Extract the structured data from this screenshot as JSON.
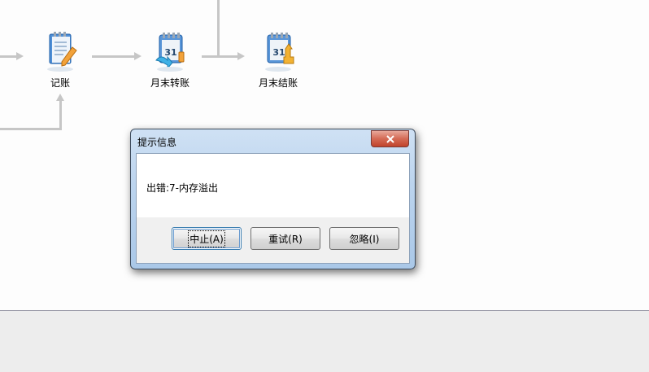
{
  "workflow": {
    "nodes": [
      {
        "label": "记账",
        "icon": "ledger-pen-icon"
      },
      {
        "label": "月末转账",
        "icon": "calendar-transfer-icon"
      },
      {
        "label": "月末结账",
        "icon": "calendar-close-icon"
      }
    ],
    "calendar_day": "31"
  },
  "dialog": {
    "title": "提示信息",
    "message": "出错:7-内存溢出",
    "buttons": {
      "abort": "中止(A)",
      "retry": "重试(R)",
      "ignore": "忽略(I)"
    },
    "close_icon": "close-icon"
  },
  "colors": {
    "connector": "#c6c6c6",
    "status_strip": "#ededed",
    "close_button": "#c0432c"
  }
}
